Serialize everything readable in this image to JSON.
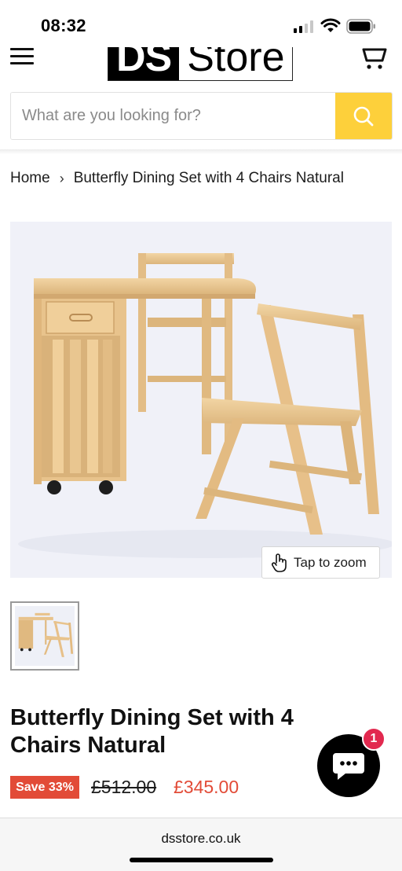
{
  "status_bar": {
    "time": "08:32"
  },
  "header": {
    "logo_left": "DS",
    "logo_right": "Store",
    "icons": [
      "menu-icon",
      "cart-icon",
      "search-icon"
    ]
  },
  "search": {
    "placeholder": "What are you looking for?",
    "value": ""
  },
  "breadcrumb": {
    "home": "Home",
    "separator": "›",
    "current": "Butterfly Dining Set with 4 Chairs Natural"
  },
  "gallery": {
    "zoom_label": "Tap to zoom",
    "thumbnail_count": 1
  },
  "product": {
    "title": "Butterfly Dining Set with 4 Chairs Natural",
    "save_label": "Save 33%",
    "compare_price": "£512.00",
    "price": "£345.00"
  },
  "chat": {
    "badge_count": "1"
  },
  "browser": {
    "url": "dsstore.co.uk"
  },
  "colors": {
    "accent_yellow": "#fdd03b",
    "sale_red": "#e24b37",
    "chat_badge": "#e2294f",
    "wood": "#e9c58f"
  }
}
